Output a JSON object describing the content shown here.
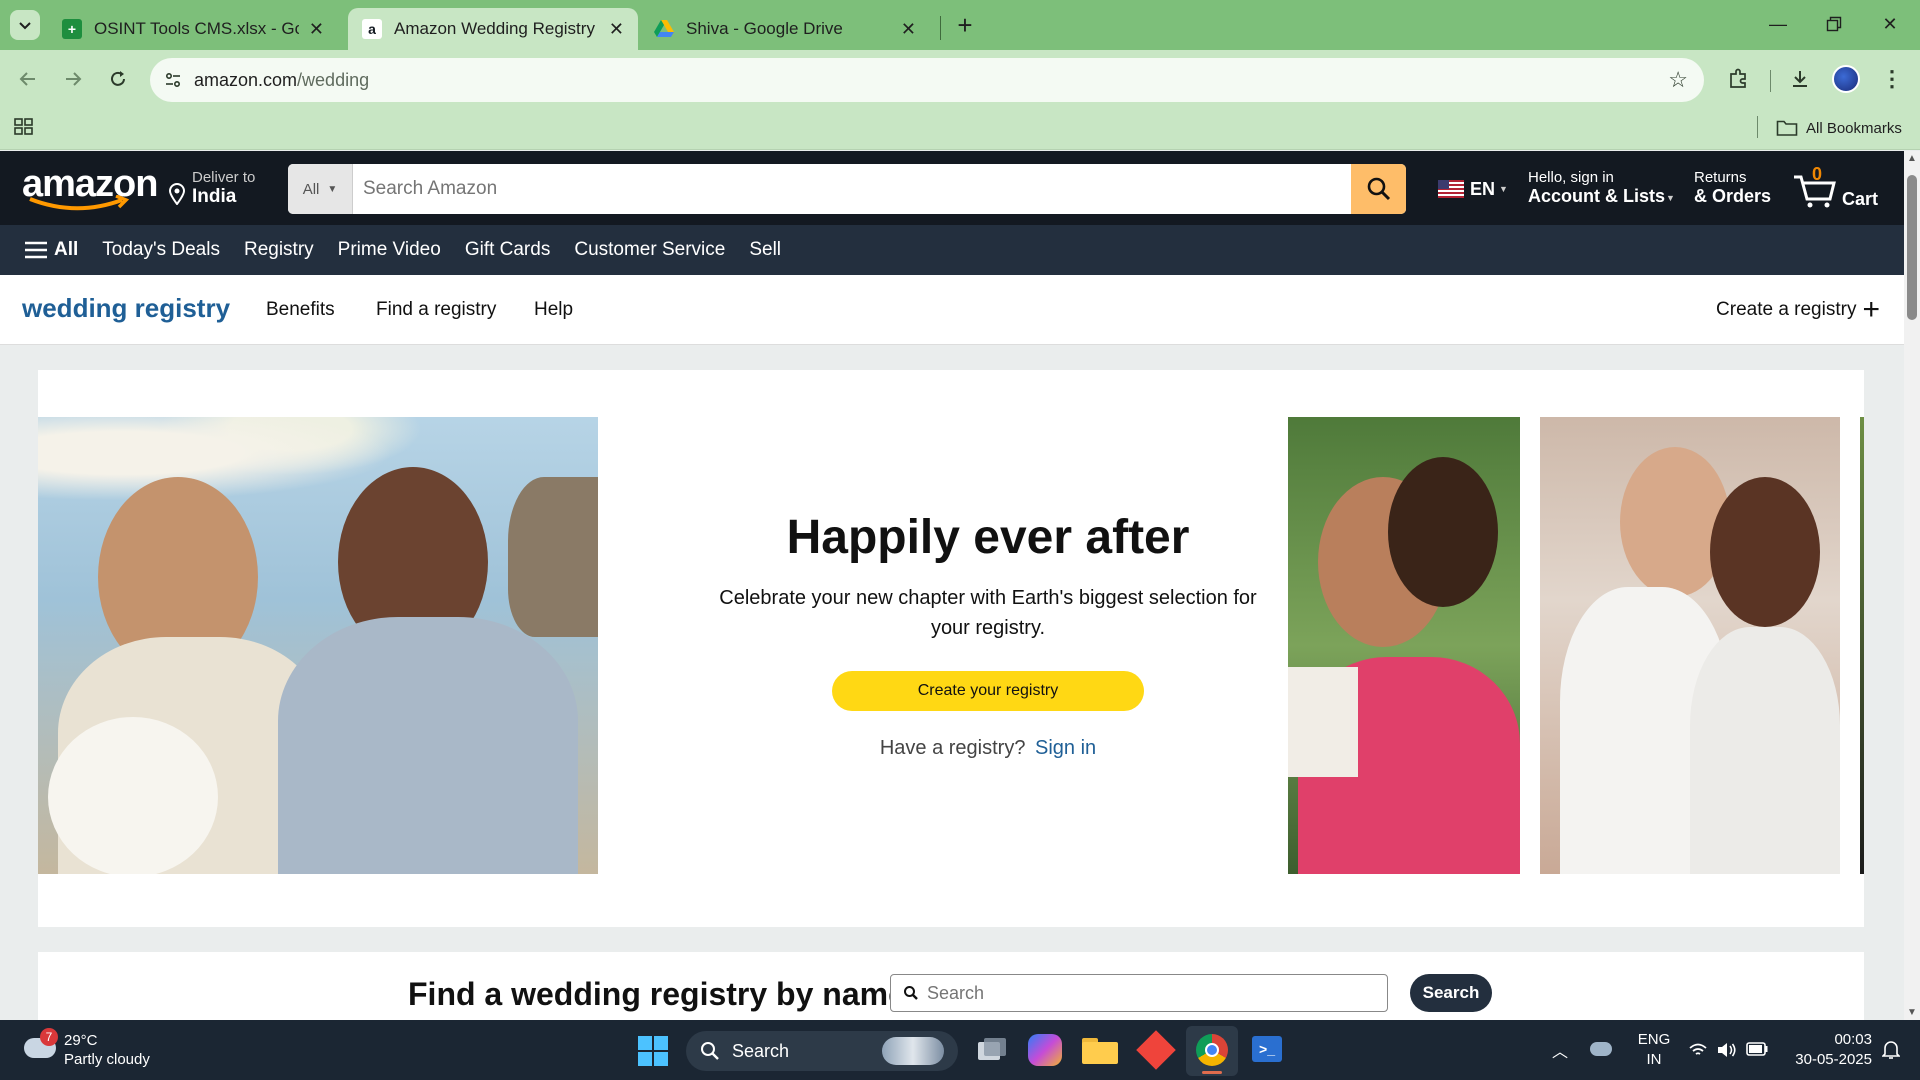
{
  "browser": {
    "tabs": [
      {
        "title": "OSINT Tools CMS.xlsx - Google",
        "icon": "sheets-icon",
        "active": false
      },
      {
        "title": "Amazon Wedding Registry",
        "icon": "amazon-icon",
        "active": true
      },
      {
        "title": "Shiva - Google Drive",
        "icon": "drive-icon",
        "active": false
      }
    ],
    "url_domain": "amazon.com",
    "url_path": "/wedding",
    "all_bookmarks": "All Bookmarks"
  },
  "amazon": {
    "logo": "amazon",
    "deliver_to_label": "Deliver to",
    "deliver_to_value": "India",
    "search_category": "All",
    "search_placeholder": "Search Amazon",
    "language": "EN",
    "account_line1": "Hello, sign in",
    "account_line2": "Account & Lists",
    "returns_line1": "Returns",
    "returns_line2": "& Orders",
    "cart_count": "0",
    "cart_label": "Cart",
    "nav": [
      "All",
      "Today's Deals",
      "Registry",
      "Prime Video",
      "Gift Cards",
      "Customer Service",
      "Sell"
    ]
  },
  "registry": {
    "brand": "wedding registry",
    "links": [
      "Benefits",
      "Find a registry",
      "Help"
    ],
    "create_link": "Create a registry",
    "hero_title": "Happily ever after",
    "hero_subtitle": "Celebrate your new chapter with Earth's biggest selection for your registry.",
    "cta": "Create your registry",
    "have_registry": "Have a registry?",
    "sign_in": "Sign in",
    "find_title": "Find a wedding registry by name",
    "find_placeholder": "Search",
    "find_button": "Search"
  },
  "taskbar": {
    "weather_temp": "29°C",
    "weather_desc": "Partly cloudy",
    "weather_badge": "7",
    "search_label": "Search",
    "lang_line1": "ENG",
    "lang_line2": "IN",
    "time": "00:03",
    "date": "30-05-2025"
  },
  "colors": {
    "tabstrip": "#7dbf7a",
    "toolbar": "#c8e6c4",
    "amazon_dark": "#131921",
    "amazon_nav": "#232f3e",
    "search_button": "#febd69",
    "cta_yellow": "#ffd814",
    "registry_blue": "#1f5f96",
    "taskbar": "#1b2633"
  }
}
